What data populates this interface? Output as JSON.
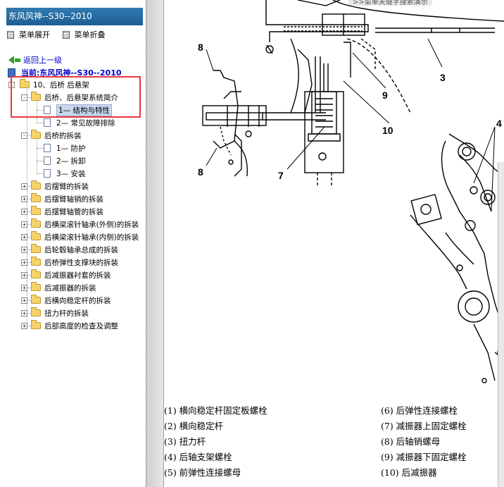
{
  "app": {
    "title": "东风风神--S30--2010"
  },
  "menu": {
    "expand_label": "菜单展开",
    "collapse_label": "菜单折叠"
  },
  "nav": {
    "back_label": "返回上一级",
    "current_label": "当前:东风风神--S30--2010"
  },
  "tree": {
    "root": "10、后桥 后悬架",
    "items": [
      "后桥、后悬架系统简介",
      "1— 结构与特性",
      "2— 常见故障排除",
      "后桥的拆装",
      "1— 防护",
      "2— 拆卸",
      "3— 安装",
      "后摆臂的拆装",
      "后摆臂轴销的拆装",
      "后摆臂轴管的拆装",
      "后横梁滚针轴承(外侧)的拆装",
      "后横梁滚针轴承(内侧)的拆装",
      "后轮毂轴承总成的拆装",
      "后桥弹性支撑块的拆装",
      "后减振器衬套的拆装",
      "后减振器的拆装",
      "后横向稳定杆的拆装",
      "扭力杆的拆装",
      "后部高度的检查及调整"
    ],
    "selected_index": 1
  },
  "banner": {
    "text": ">>菜单关键字搜索演示"
  },
  "figure": {
    "callouts": [
      "8",
      "3",
      "9",
      "10",
      "7",
      "8",
      "4"
    ]
  },
  "legend": {
    "left": [
      "(1) 横向稳定杆固定板螺栓",
      "(2) 横向稳定杆",
      "(3) 扭力杆",
      "(4) 后轴支架螺栓",
      "(5) 前弹性连接螺母"
    ],
    "right": [
      "(6) 后弹性连接螺栓",
      "(7) 减振器上固定螺栓",
      "(8) 后轴销螺母",
      "(9) 减振器下固定螺栓",
      "(10) 后减振器"
    ]
  },
  "colors": {
    "title_bar": "#2f7bb1",
    "link": "#0000cc",
    "highlight": "#e8383d",
    "selection": "#c8d8ee"
  }
}
